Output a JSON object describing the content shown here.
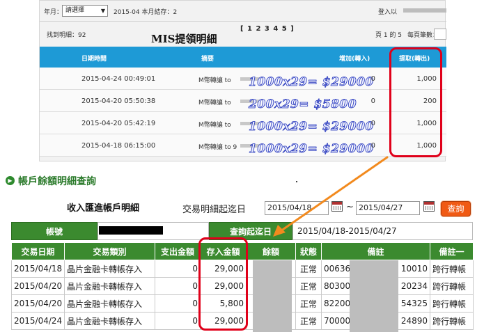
{
  "mis": {
    "month_label": "年月：",
    "month_select_value": "請選擇",
    "stock_text": "2015-04 本月結存：2",
    "login_label": "登入以",
    "found_label": "找到明細：92",
    "pages": "[ 1 2 3 4 5 ]",
    "title": "MIS提領明細",
    "page_of": "頁 1 的 5",
    "per_page_label": "每頁筆數：",
    "headers": {
      "datetime": "日期時間",
      "summary": "摘要",
      "increase": "增加(轉入)",
      "withdraw": "提取(轉出)"
    },
    "rows": [
      {
        "datetime": "2015-04-24 00:49:01",
        "desc": "M幣轉讓 to",
        "note": "1000x29= $29000",
        "increase": "0",
        "withdraw": "1,000"
      },
      {
        "datetime": "2015-04-20 05:50:38",
        "desc": "M幣轉讓 to",
        "note": "200x29= $5800",
        "increase": "0",
        "withdraw": "200"
      },
      {
        "datetime": "2015-04-20 05:42:19",
        "desc": "M幣轉讓 to",
        "note": "1000x29= $29000",
        "increase": "0",
        "withdraw": "1,000"
      },
      {
        "datetime": "2015-04-18 06:15:00",
        "desc": "M幣轉讓 to 9",
        "note": "1000x29= $29000",
        "increase": "0",
        "withdraw": "1,000"
      }
    ]
  },
  "account": {
    "section_title": "帳戶餘額明細查詢",
    "income_caption": "收入匯進帳戶明細",
    "query_label": "交易明細起迄日",
    "date_from": "2015/04/18",
    "tilde": "~",
    "date_to": "2015/04/27",
    "query_button": "查詢",
    "acct_label": "帳號",
    "range_label": "查詢起迄日",
    "range_value": "2015/04/18-2015/04/27",
    "table_headers": [
      "交易日期",
      "交易類別",
      "支出金額",
      "存入金額",
      "餘額",
      "狀態",
      "備註",
      "備註一"
    ],
    "rows": [
      {
        "date": "2015/04/18",
        "type": "晶片金融卡轉帳存入",
        "out": "0",
        "in": "29,000",
        "status": "正常",
        "memo_a": "00636",
        "memo_b": "10010",
        "memo2": "跨行轉帳"
      },
      {
        "date": "2015/04/20",
        "type": "晶片金融卡轉帳存入",
        "out": "0",
        "in": "29,000",
        "status": "正常",
        "memo_a": "80300",
        "memo_b": "20234",
        "memo2": "跨行轉帳"
      },
      {
        "date": "2015/04/20",
        "type": "晶片金融卡轉帳存入",
        "out": "0",
        "in": "5,800",
        "status": "正常",
        "memo_a": "82200",
        "memo_b": "54325",
        "memo2": "跨行轉帳"
      },
      {
        "date": "2015/04/24",
        "type": "晶片金融卡轉帳存入",
        "out": "0",
        "in": "29,000",
        "status": "正常",
        "memo_a": "70000",
        "memo_b": "24890",
        "memo2": "跨行轉帳"
      }
    ]
  },
  "colors": {
    "mis_header": "#1e9ad6",
    "green_header": "#3b8a2f",
    "highlight_red": "#e0001a",
    "arrow_orange": "#f28a1e",
    "query_button": "#f05a14"
  },
  "icons": [
    "chevron-down-icon",
    "calendar-icon",
    "arrow-icon"
  ]
}
